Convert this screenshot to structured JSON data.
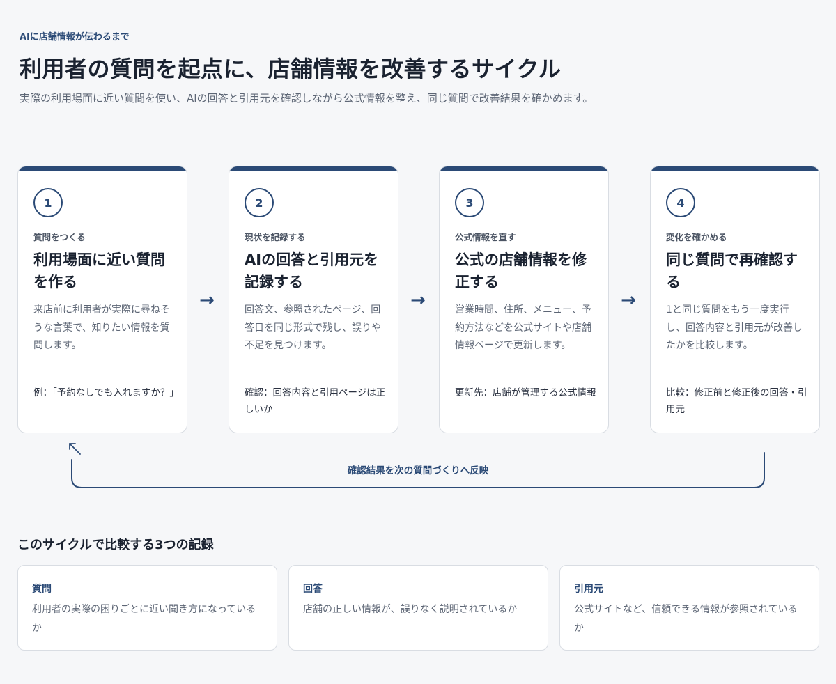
{
  "header": {
    "eyebrow": "AIに店舗情報が伝わるまで",
    "title": "利用者の質問を起点に、店舗情報を改善するサイクル",
    "subtitle": "実際の利用場面に近い質問を使い、AIの回答と引用元を確認しながら公式情報を整え、同じ質問で改善結果を確かめます。"
  },
  "steps": [
    {
      "number": "1",
      "label": "質問をつくる",
      "title": "利用場面に近い質問を作る",
      "description": "来店前に利用者が実際に尋ねそうな言葉で、知りたい情報を質問します。",
      "note": "例：「予約なしでも入れますか？」"
    },
    {
      "number": "2",
      "label": "現状を記録する",
      "title": "AIの回答と引用元を記録する",
      "description": "回答文、参照されたページ、回答日を同じ形式で残し、誤りや不足を見つけます。",
      "note": "確認：回答内容と引用ページは正しいか"
    },
    {
      "number": "3",
      "label": "公式情報を直す",
      "title": "公式の店舗情報を修正する",
      "description": "営業時間、住所、メニュー、予約方法などを公式サイトや店舗情報ページで更新します。",
      "note": "更新先：店舗が管理する公式情報"
    },
    {
      "number": "4",
      "label": "変化を確かめる",
      "title": "同じ質問で再確認する",
      "description": "1と同じ質問をもう一度実行し、回答内容と引用元が改善したかを比較します。",
      "note": "比較：修正前と修正後の回答・引用元"
    }
  ],
  "arrow_symbol": "→",
  "loop": {
    "label": "確認結果を次の質問づくりへ反映"
  },
  "records_section": {
    "title": "このサイクルで比較する3つの記録",
    "items": [
      {
        "title": "質問",
        "description": "利用者の実際の困りごとに近い聞き方になっているか"
      },
      {
        "title": "回答",
        "description": "店舗の正しい情報が、誤りなく説明されているか"
      },
      {
        "title": "引用元",
        "description": "公式サイトなど、信頼できる情報が参照されているか"
      }
    ]
  },
  "colors": {
    "accent": "#2b4a76",
    "background": "#f6f7f9"
  }
}
